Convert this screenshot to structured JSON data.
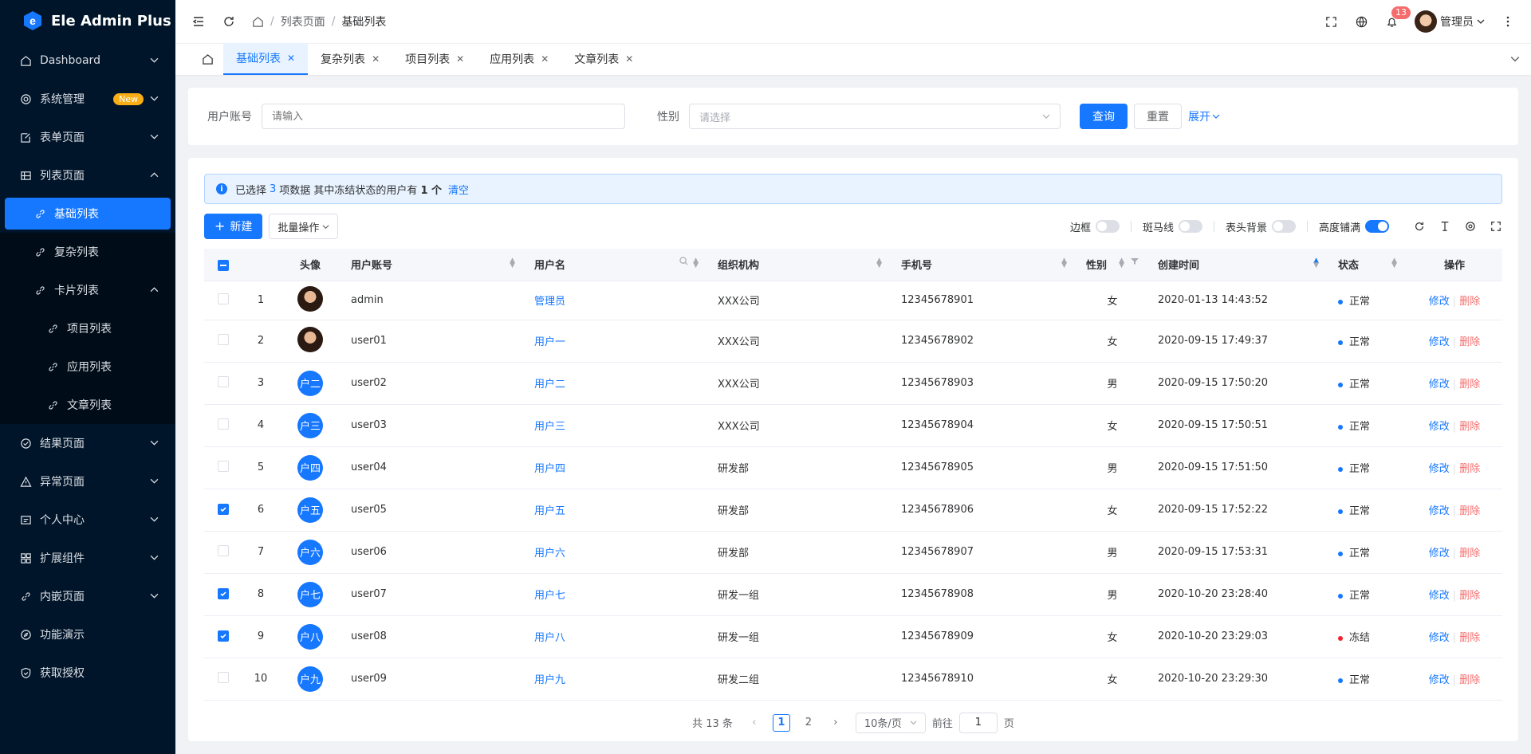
{
  "app": {
    "title": "Ele Admin Plus"
  },
  "sidebar": {
    "items": [
      {
        "label": "Dashboard",
        "icon": "home-icon"
      },
      {
        "label": "系统管理",
        "icon": "gear-icon",
        "badge": "New"
      },
      {
        "label": "表单页面",
        "icon": "edit-icon"
      },
      {
        "label": "列表页面",
        "icon": "grid-icon",
        "expanded": true
      },
      {
        "label": "基础列表",
        "icon": "link-icon",
        "active": true
      },
      {
        "label": "复杂列表",
        "icon": "link-icon"
      },
      {
        "label": "卡片列表",
        "icon": "link-icon",
        "expanded": true
      },
      {
        "label": "项目列表",
        "icon": "link-icon"
      },
      {
        "label": "应用列表",
        "icon": "link-icon"
      },
      {
        "label": "文章列表",
        "icon": "link-icon"
      },
      {
        "label": "结果页面",
        "icon": "check-circle-icon"
      },
      {
        "label": "异常页面",
        "icon": "warning-icon"
      },
      {
        "label": "个人中心",
        "icon": "user-card-icon"
      },
      {
        "label": "扩展组件",
        "icon": "puzzle-icon"
      },
      {
        "label": "内嵌页面",
        "icon": "link-icon"
      },
      {
        "label": "功能演示",
        "icon": "compass-icon"
      },
      {
        "label": "获取授权",
        "icon": "shield-icon"
      }
    ]
  },
  "header": {
    "breadcrumb": [
      "列表页面",
      "基础列表"
    ],
    "notification_count": "13",
    "user_name": "管理员"
  },
  "tabs": [
    {
      "label": "基础列表",
      "active": true
    },
    {
      "label": "复杂列表"
    },
    {
      "label": "项目列表"
    },
    {
      "label": "应用列表"
    },
    {
      "label": "文章列表"
    }
  ],
  "search": {
    "account_label": "用户账号",
    "account_placeholder": "请输入",
    "gender_label": "性别",
    "gender_placeholder": "请选择",
    "query_label": "查询",
    "reset_label": "重置",
    "expand_label": "展开"
  },
  "alert": {
    "prefix": "已选择",
    "selected": "3",
    "middle": "项数据 其中冻结状态的用户有",
    "frozen": "1 个",
    "clear_label": "清空"
  },
  "toolbar": {
    "new_label": "新建",
    "batch_label": "批量操作",
    "toggles": [
      {
        "label": "边框",
        "on": false
      },
      {
        "label": "斑马线",
        "on": false
      },
      {
        "label": "表头背景",
        "on": false
      },
      {
        "label": "高度铺满",
        "on": true
      }
    ]
  },
  "table": {
    "headers": {
      "avatar": "头像",
      "account": "用户账号",
      "name": "用户名",
      "org": "组织机构",
      "phone": "手机号",
      "gender": "性别",
      "created": "创建时间",
      "status": "状态",
      "action": "操作"
    },
    "actions": {
      "edit": "修改",
      "delete": "删除"
    },
    "rows": [
      {
        "no": "1",
        "checked": false,
        "avatar_img": true,
        "avatar": "",
        "account": "admin",
        "name": "管理员",
        "org": "XXX公司",
        "phone": "12345678901",
        "gender": "女",
        "created": "2020-01-13 14:43:52",
        "status": "正常",
        "status_color": "#1677ff"
      },
      {
        "no": "2",
        "checked": false,
        "avatar_img": true,
        "avatar": "",
        "account": "user01",
        "name": "用户一",
        "org": "XXX公司",
        "phone": "12345678902",
        "gender": "女",
        "created": "2020-09-15 17:49:37",
        "status": "正常",
        "status_color": "#1677ff"
      },
      {
        "no": "3",
        "checked": false,
        "avatar_img": false,
        "avatar": "户二",
        "account": "user02",
        "name": "用户二",
        "org": "XXX公司",
        "phone": "12345678903",
        "gender": "男",
        "created": "2020-09-15 17:50:20",
        "status": "正常",
        "status_color": "#1677ff"
      },
      {
        "no": "4",
        "checked": false,
        "avatar_img": false,
        "avatar": "户三",
        "account": "user03",
        "name": "用户三",
        "org": "XXX公司",
        "phone": "12345678904",
        "gender": "女",
        "created": "2020-09-15 17:50:51",
        "status": "正常",
        "status_color": "#1677ff"
      },
      {
        "no": "5",
        "checked": false,
        "avatar_img": false,
        "avatar": "户四",
        "account": "user04",
        "name": "用户四",
        "org": "研发部",
        "phone": "12345678905",
        "gender": "男",
        "created": "2020-09-15 17:51:50",
        "status": "正常",
        "status_color": "#1677ff"
      },
      {
        "no": "6",
        "checked": true,
        "avatar_img": false,
        "avatar": "户五",
        "account": "user05",
        "name": "用户五",
        "org": "研发部",
        "phone": "12345678906",
        "gender": "女",
        "created": "2020-09-15 17:52:22",
        "status": "正常",
        "status_color": "#1677ff"
      },
      {
        "no": "7",
        "checked": false,
        "avatar_img": false,
        "avatar": "户六",
        "account": "user06",
        "name": "用户六",
        "org": "研发部",
        "phone": "12345678907",
        "gender": "男",
        "created": "2020-09-15 17:53:31",
        "status": "正常",
        "status_color": "#1677ff"
      },
      {
        "no": "8",
        "checked": true,
        "avatar_img": false,
        "avatar": "户七",
        "account": "user07",
        "name": "用户七",
        "org": "研发一组",
        "phone": "12345678908",
        "gender": "男",
        "created": "2020-10-20 23:28:40",
        "status": "正常",
        "status_color": "#1677ff"
      },
      {
        "no": "9",
        "checked": true,
        "avatar_img": false,
        "avatar": "户八",
        "account": "user08",
        "name": "用户八",
        "org": "研发一组",
        "phone": "12345678909",
        "gender": "女",
        "created": "2020-10-20 23:29:03",
        "status": "冻结",
        "status_color": "#f5222d"
      },
      {
        "no": "10",
        "checked": false,
        "avatar_img": false,
        "avatar": "户九",
        "account": "user09",
        "name": "用户九",
        "org": "研发二组",
        "phone": "12345678910",
        "gender": "女",
        "created": "2020-10-20 23:29:30",
        "status": "正常",
        "status_color": "#1677ff"
      }
    ]
  },
  "pagination": {
    "total": "共 13 条",
    "pages": [
      "1",
      "2"
    ],
    "current": "1",
    "page_size": "10条/页",
    "goto_label": "前往",
    "goto_value": "1",
    "page_suffix": "页"
  }
}
